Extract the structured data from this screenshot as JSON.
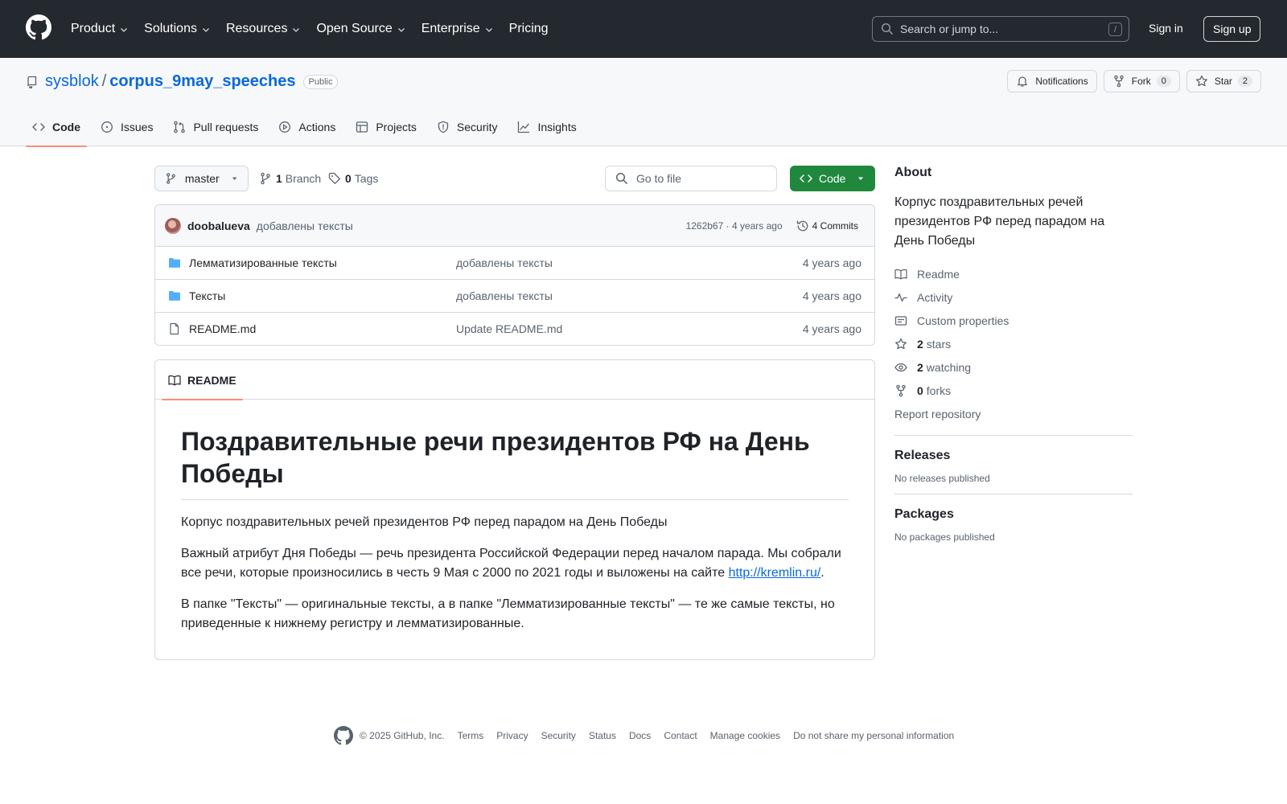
{
  "header": {
    "nav": [
      "Product",
      "Solutions",
      "Resources",
      "Open Source",
      "Enterprise",
      "Pricing"
    ],
    "nav_has_dropdown": [
      true,
      true,
      true,
      true,
      true,
      false
    ],
    "search_placeholder": "Search or jump to...",
    "search_key": "/",
    "sign_in": "Sign in",
    "sign_up": "Sign up"
  },
  "repo": {
    "owner": "sysblok",
    "separator": "/",
    "name": "corpus_9may_speeches",
    "visibility": "Public",
    "notifications": "Notifications",
    "fork_label": "Fork",
    "fork_count": "0",
    "star_label": "Star",
    "star_count": "2"
  },
  "tabs": [
    {
      "label": "Code",
      "icon": "code-icon",
      "active": true
    },
    {
      "label": "Issues",
      "icon": "issue-icon",
      "active": false
    },
    {
      "label": "Pull requests",
      "icon": "pull-request-icon",
      "active": false
    },
    {
      "label": "Actions",
      "icon": "play-icon",
      "active": false
    },
    {
      "label": "Projects",
      "icon": "table-icon",
      "active": false
    },
    {
      "label": "Security",
      "icon": "shield-icon",
      "active": false
    },
    {
      "label": "Insights",
      "icon": "graph-icon",
      "active": false
    }
  ],
  "toolbar": {
    "branch": "master",
    "branch_count": "1",
    "branch_label": "Branch",
    "tag_count": "0",
    "tag_label": "Tags",
    "goto_placeholder": "Go to file",
    "code_button": "Code"
  },
  "commit": {
    "author": "doobalueva",
    "message": "добавлены тексты",
    "hash_time": "1262b67 · 4 years ago",
    "commits": "4 Commits"
  },
  "files": [
    {
      "type": "folder",
      "name": "Лемматизированные тексты",
      "message": "добавлены тексты",
      "date": "4 years ago"
    },
    {
      "type": "folder",
      "name": "Тексты",
      "message": "добавлены тексты",
      "date": "4 years ago"
    },
    {
      "type": "file",
      "name": "README.md",
      "message": "Update README.md",
      "date": "4 years ago"
    }
  ],
  "readme": {
    "tab": "README",
    "title": "Поздравительные речи президентов РФ на День Победы",
    "p1": "Корпус поздравительных речей президентов РФ перед парадом на День Победы",
    "p2_before": "Важный атрибут Дня Победы — речь президента Российской Федерации перед началом парада. Мы собрали все речи, которые произносились в честь 9 Мая с 2000 по 2021 годы и выложены на сайте ",
    "p2_link": "http://kremlin.ru/",
    "p2_after": ".",
    "p3": "В папке \"Тексты\" — оригинальные тексты, а в папке \"Лемматизированные тексты\" — те же самые тексты, но приведенные к нижнему регистру и лемматизированные."
  },
  "sidebar": {
    "about_title": "About",
    "description": "Корпус поздравительных речей президентов РФ перед парадом на День Победы",
    "readme": "Readme",
    "activity": "Activity",
    "custom_properties": "Custom properties",
    "stars_count": "2",
    "stars_label": "stars",
    "watching_count": "2",
    "watching_label": "watching",
    "forks_count": "0",
    "forks_label": "forks",
    "report": "Report repository",
    "releases_title": "Releases",
    "releases_empty": "No releases published",
    "packages_title": "Packages",
    "packages_empty": "No packages published"
  },
  "footer": {
    "copyright": "© 2025 GitHub, Inc.",
    "links": [
      "Terms",
      "Privacy",
      "Security",
      "Status",
      "Docs",
      "Contact",
      "Manage cookies",
      "Do not share my personal information"
    ]
  },
  "colors": {
    "header_bg": "#24292f",
    "link_blue": "#0969da",
    "code_button_green": "#1f883d",
    "tab_underline": "#fd8c73",
    "folder_blue": "#54aeff"
  }
}
